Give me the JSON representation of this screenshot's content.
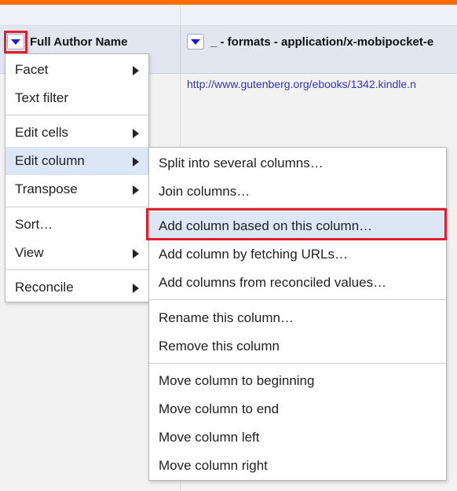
{
  "columns": {
    "first": {
      "title": "Full Author Name"
    },
    "second": {
      "title": "_ - formats - application/x-mobipocket-e"
    }
  },
  "cells": {
    "second_row1": "http://www.gutenberg.org/ebooks/1342.kindle.n"
  },
  "menu": {
    "facet": "Facet",
    "text_filter": "Text filter",
    "edit_cells": "Edit cells",
    "edit_column": "Edit column",
    "transpose": "Transpose",
    "sort": "Sort…",
    "view": "View",
    "reconcile": "Reconcile"
  },
  "submenu": {
    "split": "Split into several columns…",
    "join": "Join columns…",
    "add_based": "Add column based on this column…",
    "add_fetch": "Add column by fetching URLs…",
    "add_reconciled": "Add columns from reconciled values…",
    "rename": "Rename this column…",
    "remove": "Remove this column",
    "move_beginning": "Move column to beginning",
    "move_end": "Move column to end",
    "move_left": "Move column left",
    "move_right": "Move column right"
  },
  "colors": {
    "accent_bar": "#ff6a00",
    "highlight_box": "#e0202c",
    "dropdown_arrow": "#1a1adc",
    "hover_item": "#dce7f6",
    "link": "#3333cc"
  }
}
